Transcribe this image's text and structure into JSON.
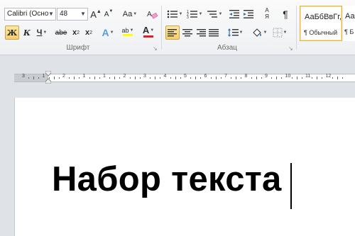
{
  "ribbon": {
    "font_group": {
      "label": "Шрифт",
      "font_name": "Calibri (Осно",
      "font_size": "48",
      "grow_font": "A",
      "shrink_font": "A",
      "change_case": "Aa",
      "bold": "Ж",
      "italic": "К",
      "underline": "Ч",
      "strikethrough": "abe",
      "subscript": "x",
      "subscript_mark": "2",
      "superscript": "x",
      "superscript_mark": "2",
      "text_effects": "A",
      "highlight": "ab",
      "font_color": "A",
      "launcher": "↘"
    },
    "paragraph_group": {
      "label": "Абзац",
      "sort": "A",
      "sort_b": "Я",
      "show_marks": "¶",
      "launcher": "↘"
    },
    "styles_group": {
      "normal_preview": "АаБбВвГг,",
      "normal_name": "¶ Обычный",
      "next_preview": "Аа",
      "next_name": "¶ Б"
    }
  },
  "ruler": {
    "numbers": [
      "3",
      "1",
      "2",
      "1",
      "1",
      "2",
      "3",
      "4",
      "5",
      "6",
      "7",
      "8",
      "9",
      "10",
      "11",
      "12"
    ]
  },
  "document": {
    "text": "Набор текста"
  },
  "colors": {
    "ribbon_bg": "#eef0f3",
    "active_button": "#f7cf6a",
    "font_color_bar": "#e02020",
    "highlight_bar": "#ffff00"
  }
}
